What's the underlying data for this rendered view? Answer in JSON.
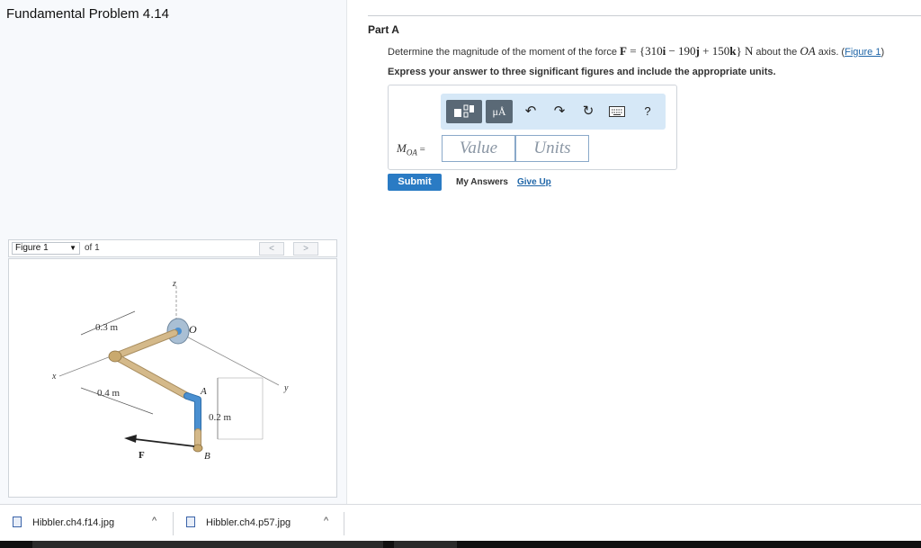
{
  "problem": {
    "title": "Fundamental Problem 4.14"
  },
  "figure_bar": {
    "select_value": "Figure 1",
    "of_label": "of 1",
    "prev_label": "<",
    "next_label": ">"
  },
  "figure": {
    "labels": {
      "z": "z",
      "x": "x",
      "y": "y",
      "o": "O",
      "a": "A",
      "b": "B",
      "f": "F",
      "d1": "0.3 m",
      "d2": "0.4 m",
      "d3": "0.2 m"
    }
  },
  "part": {
    "title": "Part A",
    "question_prefix": "Determine the magnitude of the moment of the force",
    "force_symbol": "F",
    "force_eq": " = {310",
    "i": "i",
    "minus": " − 190",
    "j": "j",
    "plus": " + 150",
    "k": "k",
    "force_end": "} N",
    "about_text": " about the",
    "axis_name": "OA",
    "axis_suffix": " axis. (",
    "figure_link": "Figure 1",
    "close_paren": ")",
    "instruction": "Express your answer to three significant figures and include the appropriate units."
  },
  "toolbar": {
    "units_button_label": "μÅ",
    "undo_icon": "undo-icon",
    "redo_icon": "redo-icon",
    "reset_icon": "reset-icon",
    "keyboard_icon": "keyboard-icon",
    "help_label": "?"
  },
  "answer": {
    "label_main": "M",
    "label_sub": "OA",
    "label_eq": " =",
    "value_placeholder": "Value",
    "units_placeholder": "Units"
  },
  "actions": {
    "submit_label": "Submit",
    "my_answers_label": "My Answers",
    "give_up_label": "Give Up"
  },
  "downloads": [
    {
      "name": "Hibbler.ch4.f14.jpg"
    },
    {
      "name": "Hibbler.ch4.p57.jpg"
    }
  ],
  "colors": {
    "accent": "#2a7bc4",
    "link": "#1f66a8",
    "toolbar_bg": "#d6e8f7",
    "pipe_tan": "#d4b98a",
    "pipe_blue": "#4a8fd0"
  }
}
